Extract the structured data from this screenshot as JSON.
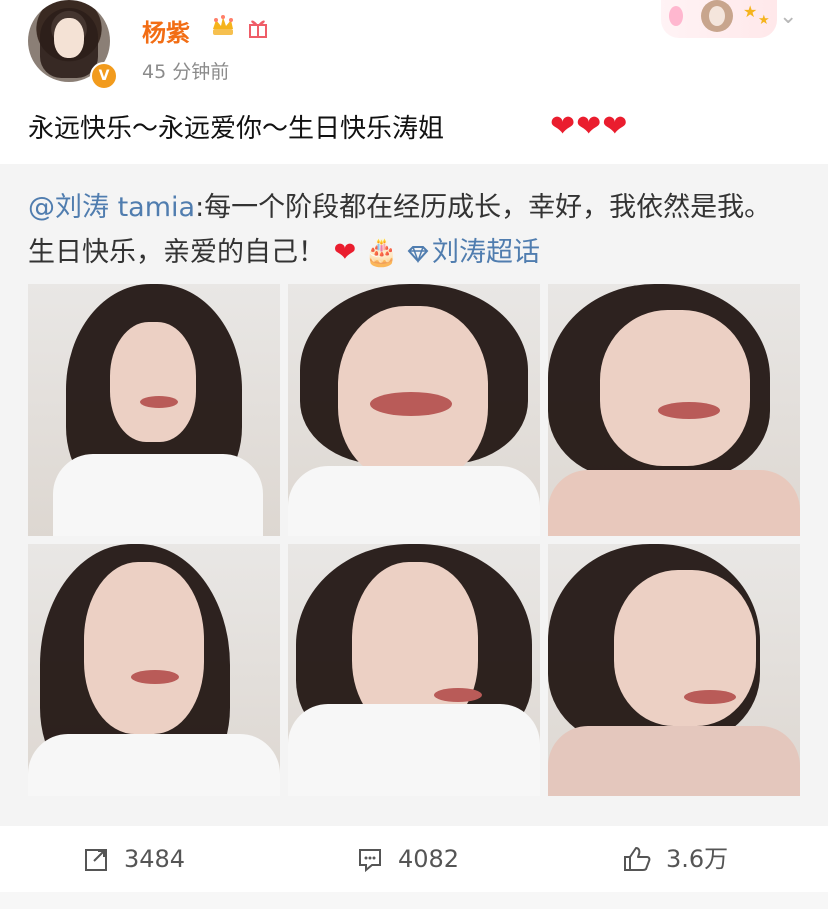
{
  "post": {
    "author": "杨紫",
    "time": "45 分钟前",
    "verified_mark": "V",
    "text": "永远快乐～永远爱你～生日快乐涛姐",
    "hearts": "❤❤❤"
  },
  "repost": {
    "mention": "@刘涛 tamia",
    "body_1": ":每一个阶段都在经历成长，幸好，我依然是我。生日快乐，亲爱的自己！",
    "heart": "❤",
    "cake": "🎂",
    "topic": "刘涛超话"
  },
  "stats": {
    "reposts": "3484",
    "comments": "4082",
    "likes": "3.6万"
  },
  "icons": {
    "crown": "crown-icon",
    "gift": "gift-icon",
    "share": "share-icon",
    "comment": "comment-icon",
    "like": "like-icon",
    "chevron": "chevron-down-icon",
    "diamond": "diamond-icon"
  },
  "colors": {
    "author": "#f26d14",
    "link": "#507daf",
    "heart": "#ea1d2e",
    "panel": "#f4f4f4"
  }
}
